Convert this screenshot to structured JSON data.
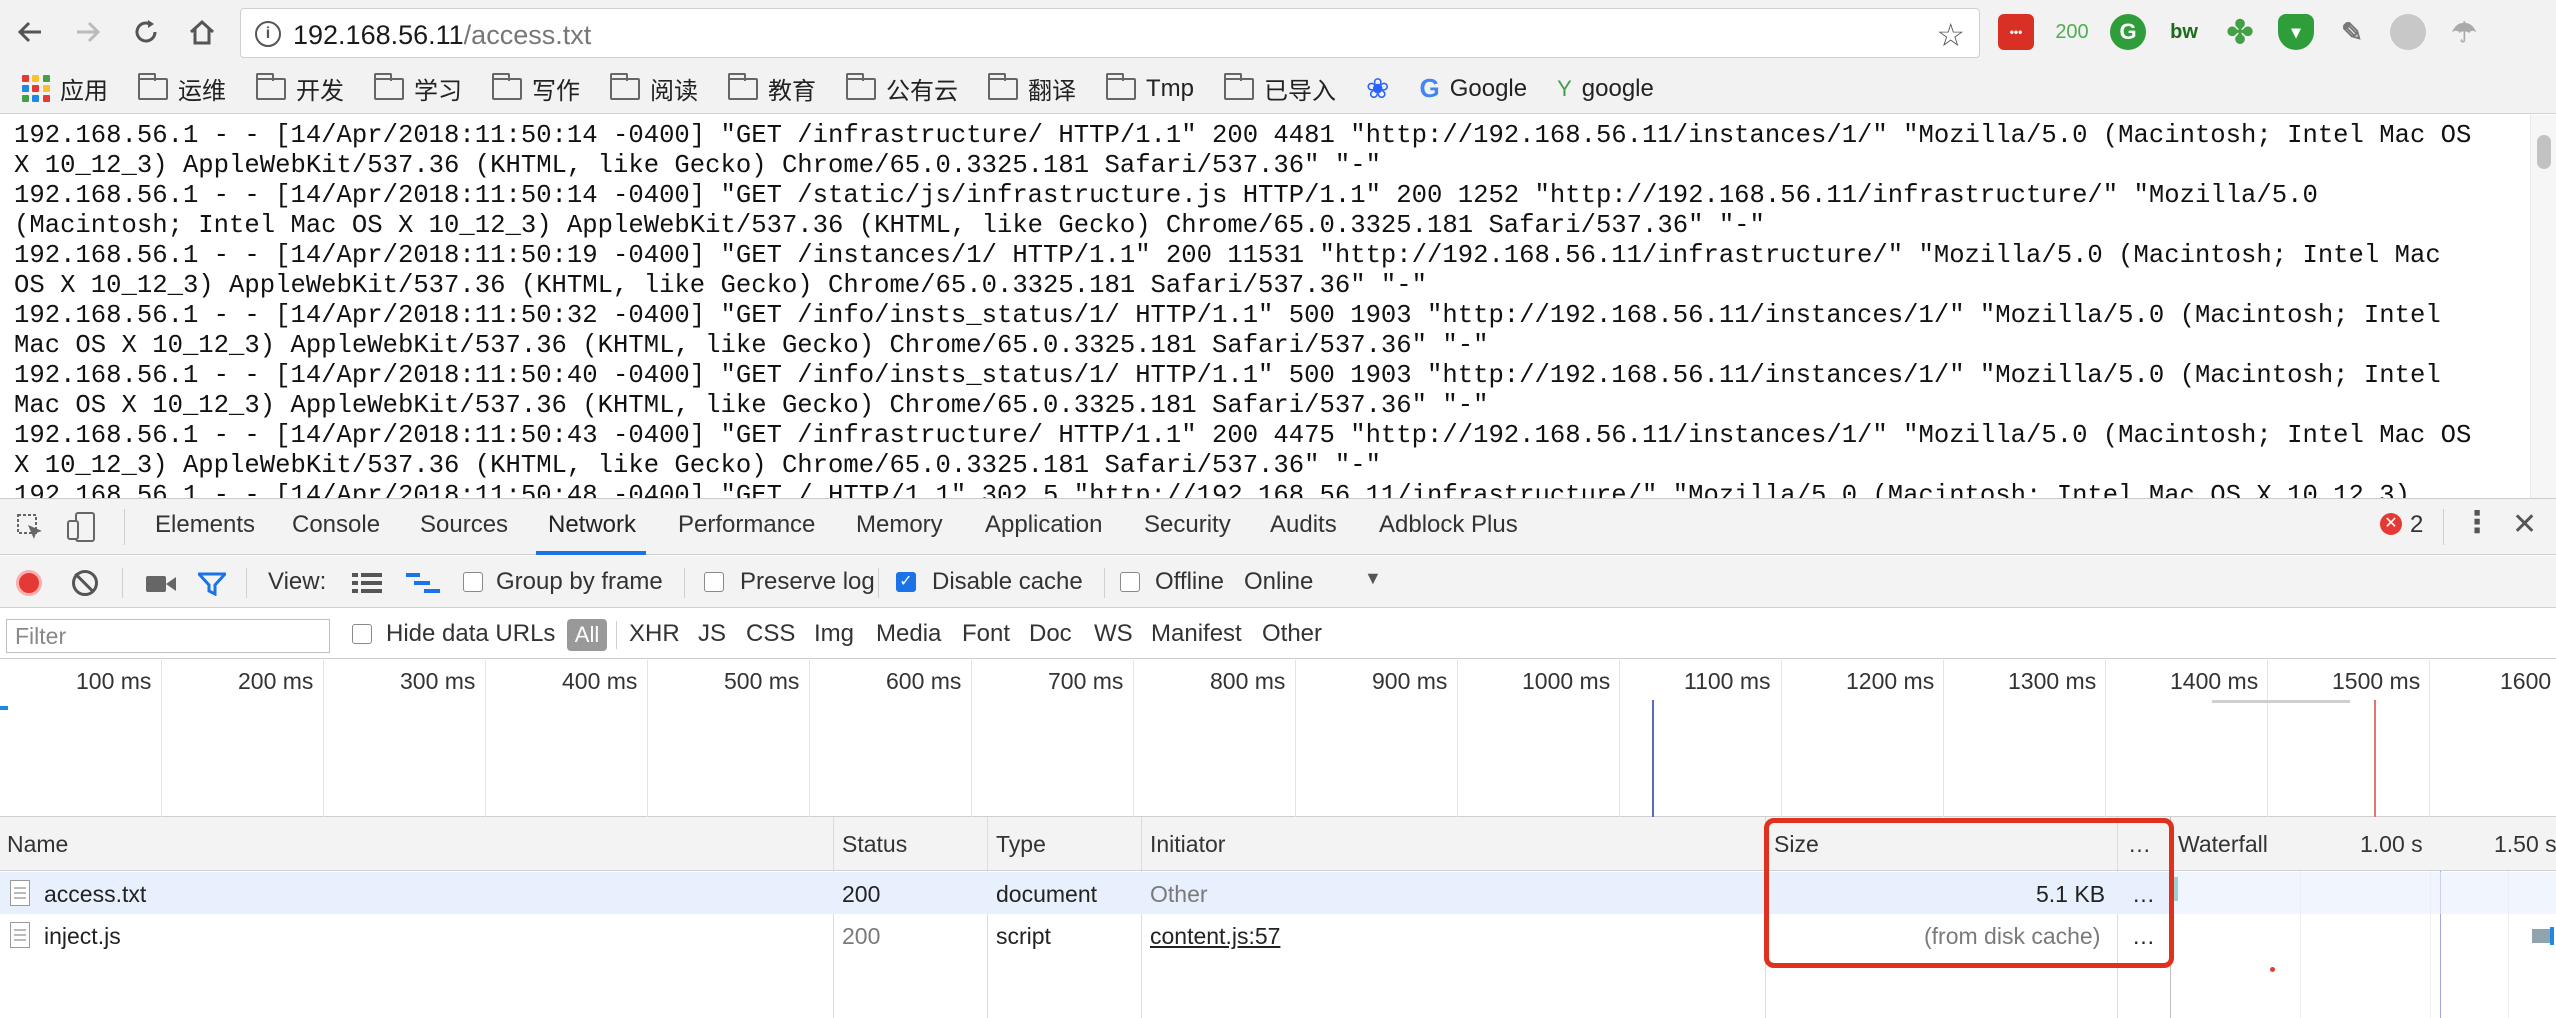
{
  "browser": {
    "url_host": "192.168.56.11",
    "url_path": "/access.txt",
    "extension_badge": "200",
    "extension_text": "bw"
  },
  "bookmarks": {
    "apps_label": "应用",
    "folders": [
      "运维",
      "开发",
      "学习",
      "写作",
      "阅读",
      "教育",
      "公有云",
      "翻译",
      "Tmp",
      "已导入"
    ],
    "google_label": "Google",
    "google2_label": "google"
  },
  "page": {
    "log_text": "192.168.56.1 - - [14/Apr/2018:11:50:14 -0400] \"GET /infrastructure/ HTTP/1.1\" 200 4481 \"http://192.168.56.11/instances/1/\" \"Mozilla/5.0 (Macintosh; Intel Mac OS\nX 10_12_3) AppleWebKit/537.36 (KHTML, like Gecko) Chrome/65.0.3325.181 Safari/537.36\" \"-\"\n192.168.56.1 - - [14/Apr/2018:11:50:14 -0400] \"GET /static/js/infrastructure.js HTTP/1.1\" 200 1252 \"http://192.168.56.11/infrastructure/\" \"Mozilla/5.0\n(Macintosh; Intel Mac OS X 10_12_3) AppleWebKit/537.36 (KHTML, like Gecko) Chrome/65.0.3325.181 Safari/537.36\" \"-\"\n192.168.56.1 - - [14/Apr/2018:11:50:19 -0400] \"GET /instances/1/ HTTP/1.1\" 200 11531 \"http://192.168.56.11/infrastructure/\" \"Mozilla/5.0 (Macintosh; Intel Mac\nOS X 10_12_3) AppleWebKit/537.36 (KHTML, like Gecko) Chrome/65.0.3325.181 Safari/537.36\" \"-\"\n192.168.56.1 - - [14/Apr/2018:11:50:32 -0400] \"GET /info/insts_status/1/ HTTP/1.1\" 500 1903 \"http://192.168.56.11/instances/1/\" \"Mozilla/5.0 (Macintosh; Intel\nMac OS X 10_12_3) AppleWebKit/537.36 (KHTML, like Gecko) Chrome/65.0.3325.181 Safari/537.36\" \"-\"\n192.168.56.1 - - [14/Apr/2018:11:50:40 -0400] \"GET /info/insts_status/1/ HTTP/1.1\" 500 1903 \"http://192.168.56.11/instances/1/\" \"Mozilla/5.0 (Macintosh; Intel\nMac OS X 10_12_3) AppleWebKit/537.36 (KHTML, like Gecko) Chrome/65.0.3325.181 Safari/537.36\" \"-\"\n192.168.56.1 - - [14/Apr/2018:11:50:43 -0400] \"GET /infrastructure/ HTTP/1.1\" 200 4475 \"http://192.168.56.11/instances/1/\" \"Mozilla/5.0 (Macintosh; Intel Mac OS\nX 10_12_3) AppleWebKit/537.36 (KHTML, like Gecko) Chrome/65.0.3325.181 Safari/537.36\" \"-\"\n192.168.56.1 - - [14/Apr/2018:11:50:48 -0400] \"GET / HTTP/1.1\" 302 5 \"http://192.168.56.11/infrastructure/\" \"Mozilla/5.0 (Macintosh; Intel Mac OS X 10_12_3)"
  },
  "devtools": {
    "tabs": [
      "Elements",
      "Console",
      "Sources",
      "Network",
      "Performance",
      "Memory",
      "Application",
      "Security",
      "Audits",
      "Adblock Plus"
    ],
    "active_tab": "Network",
    "error_count": "2",
    "view_label": "View:",
    "group_by_frame": "Group by frame",
    "preserve_log": "Preserve log",
    "disable_cache": "Disable cache",
    "disable_cache_checked": true,
    "offline": "Offline",
    "throttle_value": "Online",
    "filter_placeholder": "Filter",
    "hide_data_urls": "Hide data URLs",
    "type_filters": [
      "All",
      "XHR",
      "JS",
      "CSS",
      "Img",
      "Media",
      "Font",
      "Doc",
      "WS",
      "Manifest",
      "Other"
    ],
    "timeline_ticks": [
      "100 ms",
      "200 ms",
      "300 ms",
      "400 ms",
      "500 ms",
      "600 ms",
      "700 ms",
      "800 ms",
      "900 ms",
      "1000 ms",
      "1100 ms",
      "1200 ms",
      "1300 ms",
      "1400 ms",
      "1500 ms",
      "1600"
    ],
    "columns": {
      "name": "Name",
      "status": "Status",
      "type": "Type",
      "initiator": "Initiator",
      "size": "Size",
      "more": "…",
      "waterfall": "Waterfall",
      "wf_tick1": "1.00 s",
      "wf_tick2": "1.50 s"
    },
    "rows": [
      {
        "name": "access.txt",
        "status": "200",
        "type": "document",
        "initiator": "Other",
        "size": "5.1 KB",
        "more": "…"
      },
      {
        "name": "inject.js",
        "status": "200",
        "type": "script",
        "initiator": "content.js:57",
        "size": "(from disk cache)",
        "more": "…"
      }
    ],
    "colors": {
      "accent": "#1a73e8",
      "record": "#e53935",
      "highlight": "#e0301e"
    }
  }
}
